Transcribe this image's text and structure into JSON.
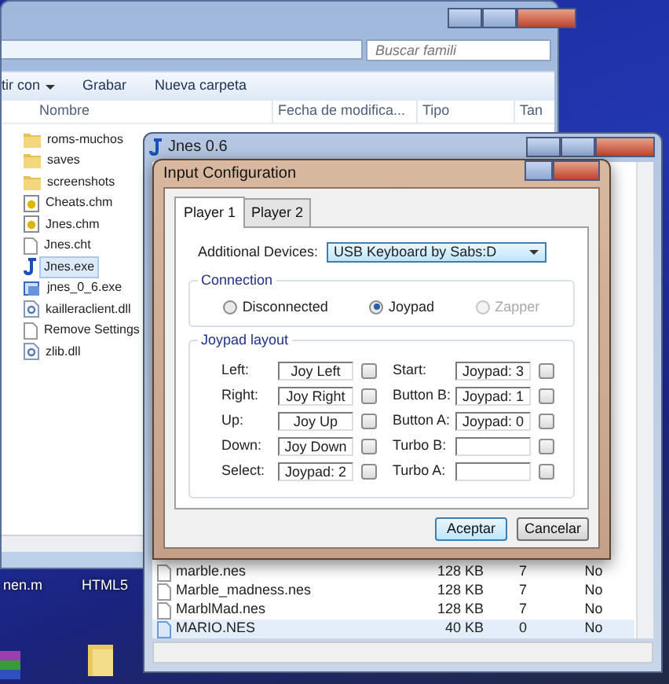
{
  "explorer": {
    "search": {
      "placeholder": "Buscar famili"
    },
    "toolbar": [
      {
        "label": "tir con",
        "dropdown": true
      },
      {
        "label": "Grabar",
        "dropdown": false
      },
      {
        "label": "Nueva carpeta",
        "dropdown": false
      }
    ],
    "columns": [
      "Nombre",
      "Fecha de modifica...",
      "Tipo",
      "Tan"
    ],
    "files": [
      {
        "name": "roms-muchos",
        "kind": "folder",
        "selected": false
      },
      {
        "name": "saves",
        "kind": "folder",
        "selected": false
      },
      {
        "name": "screenshots",
        "kind": "folder",
        "selected": false
      },
      {
        "name": "Cheats.chm",
        "kind": "help",
        "selected": false
      },
      {
        "name": "Jnes.chm",
        "kind": "help",
        "selected": false
      },
      {
        "name": "Jnes.cht",
        "kind": "document",
        "selected": false
      },
      {
        "name": "Jnes.exe",
        "kind": "app",
        "selected": true
      },
      {
        "name": "jnes_0_6.exe",
        "kind": "installer",
        "selected": false
      },
      {
        "name": "kailleraclient.dll",
        "kind": "library",
        "selected": false
      },
      {
        "name": "Remove Settings",
        "kind": "document",
        "selected": false
      },
      {
        "name": "zlib.dll",
        "kind": "library",
        "selected": false
      }
    ]
  },
  "desktop_icons": [
    {
      "label": "nen.m"
    },
    {
      "label": "HTML5"
    }
  ],
  "jnes_window": {
    "title": "Jnes 0.6",
    "rows": [
      {
        "name": "marble.nes",
        "size": "128 KB",
        "column_3": "7",
        "column_4": "No",
        "selected": false
      },
      {
        "name": "Marble_madness.nes",
        "size": "128 KB",
        "column_3": "7",
        "column_4": "No",
        "selected": false
      },
      {
        "name": "MarblMad.nes",
        "size": "128 KB",
        "column_3": "7",
        "column_4": "No",
        "selected": false
      },
      {
        "name": "MARIO.NES",
        "size": "40 KB",
        "column_3": "0",
        "column_4": "No",
        "selected": true
      }
    ]
  },
  "dialog": {
    "title": "Input Configuration",
    "tabs": [
      {
        "label": "Player 1",
        "selected": true
      },
      {
        "label": "Player 2",
        "selected": false
      }
    ],
    "additional_devices": {
      "label": "Additional Devices:",
      "value": "USB Keyboard by Sabs:D"
    },
    "connection": {
      "title": "Connection",
      "options": [
        {
          "label": "Disconnected",
          "selected": false,
          "disabled": false
        },
        {
          "label": "Joypad",
          "selected": true,
          "disabled": false
        },
        {
          "label": "Zapper",
          "selected": false,
          "disabled": true
        }
      ]
    },
    "joypad_layout": {
      "title": "Joypad layout",
      "left": [
        {
          "label": "Left:",
          "value": "Joy Left"
        },
        {
          "label": "Right:",
          "value": "Joy Right"
        },
        {
          "label": "Up:",
          "value": "Joy Up"
        },
        {
          "label": "Down:",
          "value": "Joy Down"
        },
        {
          "label": "Select:",
          "value": "Joypad: 2"
        }
      ],
      "right": [
        {
          "label": "Start:",
          "value": "Joypad: 3"
        },
        {
          "label": "Button B:",
          "value": "Joypad: 1"
        },
        {
          "label": "Button A:",
          "value": "Joypad: 0"
        },
        {
          "label": "Turbo B:"
        },
        {
          "label": "Turbo A:"
        }
      ]
    },
    "buttons": [
      {
        "label": "Aceptar",
        "default": true
      },
      {
        "label": "Cancelar",
        "default": false
      }
    ]
  }
}
